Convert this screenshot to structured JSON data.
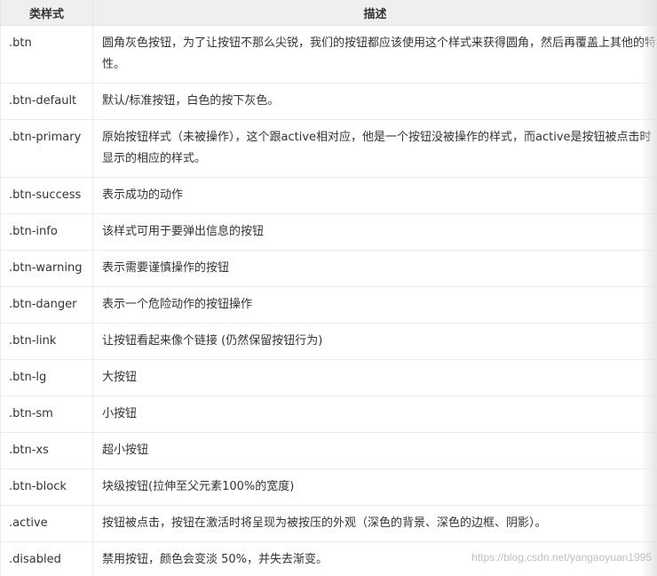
{
  "table": {
    "headers": [
      "类样式",
      "描述"
    ],
    "rows": [
      {
        "cls": ".btn",
        "desc": "圆角灰色按钮，为了让按钮不那么尖锐，我们的按钮都应该使用这个样式来获得圆角，然后再覆盖上其他的特性。"
      },
      {
        "cls": ".btn-default",
        "desc": "默认/标准按钮，白色的按下灰色。"
      },
      {
        "cls": ".btn-primary",
        "desc": "原始按钮样式（未被操作），这个跟active相对应，他是一个按钮没被操作的样式，而active是按钮被点击时显示的相应的样式。"
      },
      {
        "cls": ".btn-success",
        "desc": "表示成功的动作"
      },
      {
        "cls": ".btn-info",
        "desc": "该样式可用于要弹出信息的按钮"
      },
      {
        "cls": ".btn-warning",
        "desc": "表示需要谨慎操作的按钮"
      },
      {
        "cls": ".btn-danger",
        "desc": "表示一个危险动作的按钮操作"
      },
      {
        "cls": ".btn-link",
        "desc": "让按钮看起来像个链接 (仍然保留按钮行为)"
      },
      {
        "cls": ".btn-lg",
        "desc": "大按钮"
      },
      {
        "cls": ".btn-sm",
        "desc": "小按钮"
      },
      {
        "cls": ".btn-xs",
        "desc": "超小按钮"
      },
      {
        "cls": ".btn-block",
        "desc": "块级按钮(拉伸至父元素100%的宽度)"
      },
      {
        "cls": ".active",
        "desc": "按钮被点击，按钮在激活时将呈现为被按压的外观（深色的背景、深色的边框、阴影）。"
      },
      {
        "cls": ".disabled",
        "desc": "禁用按钮，颜色会变淡 50%，并失去渐变。"
      }
    ]
  },
  "watermark": "https://blog.csdn.net/yangaoyuan1995"
}
